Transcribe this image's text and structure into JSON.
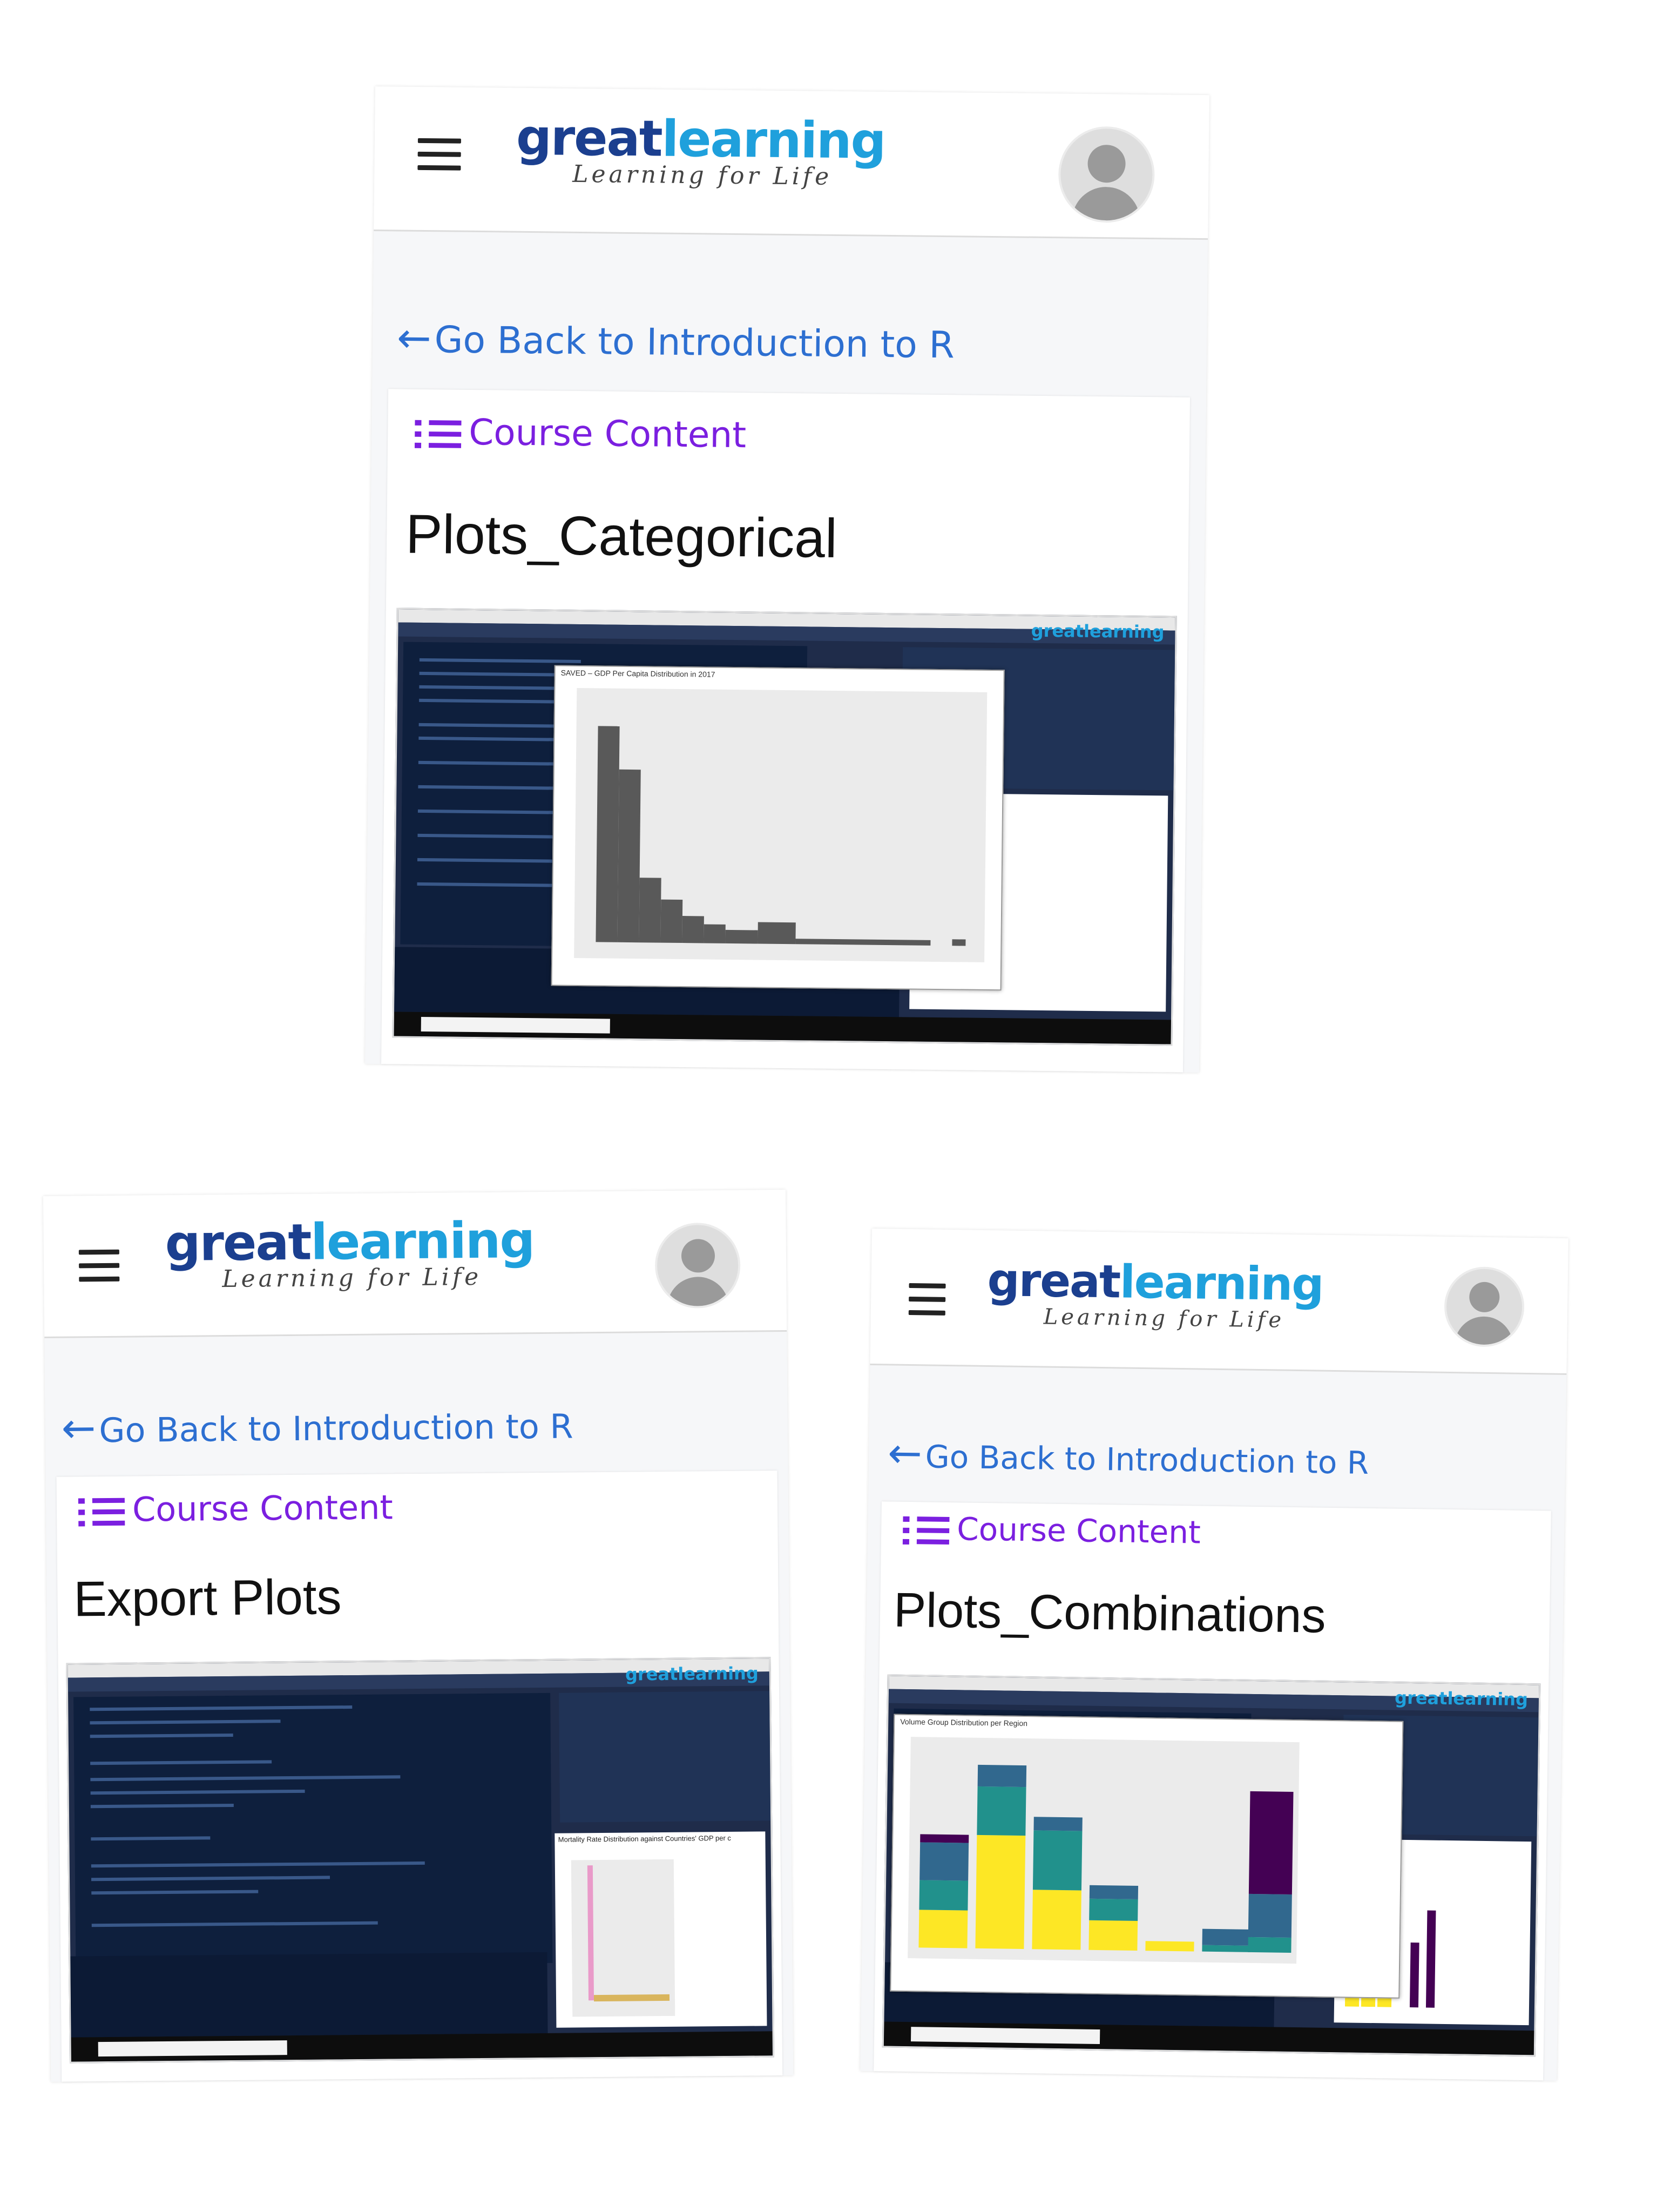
{
  "header": {
    "logo_part1": "great",
    "logo_part2": "learning",
    "logo_tagline": "Learning for Life"
  },
  "nav": {
    "back_arrow": "←",
    "back_link": "Go Back to Introduction to R",
    "course_content": "Course Content"
  },
  "icons": [
    "hamburger-menu-icon",
    "avatar-icon",
    "back-arrow-icon",
    "list-icon"
  ],
  "colors": {
    "logo_dark": "#1b3f8f",
    "logo_light": "#1fa0dc",
    "link_blue": "#2d6fd1",
    "course_purple": "#7b1fe0"
  },
  "cards": [
    {
      "title": "Plots_Categorical",
      "thumb_popup_title": "SAVED – GDP Per Capita Distribution in 2017"
    },
    {
      "title": "Export Plots",
      "thumb_popup_title": "Mortality Rate Distribution against Countries' GDP per c"
    },
    {
      "title": "Plots_Combinations",
      "thumb_popup_title": "Volume Group Distribution per Region"
    }
  ],
  "thumb_brand": "greatlearning"
}
